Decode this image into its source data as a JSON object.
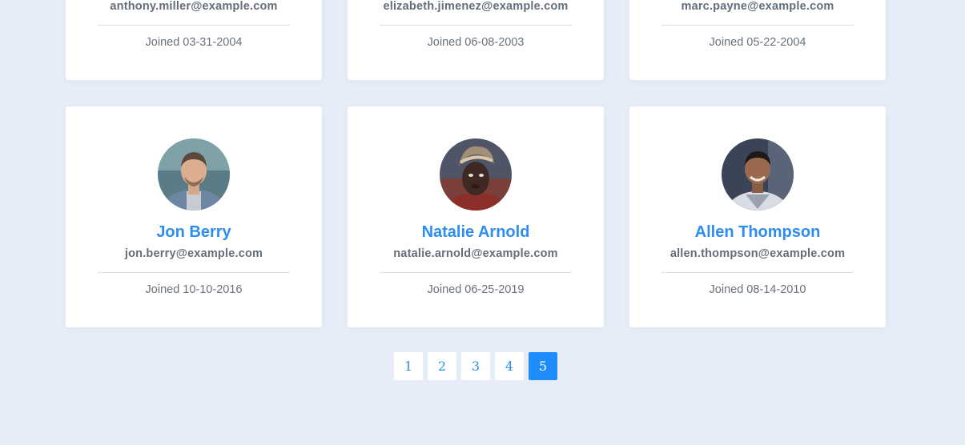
{
  "users": {
    "top_row": [
      {
        "email": "anthony.miller@example.com",
        "joined": "Joined 03-31-2004"
      },
      {
        "email": "elizabeth.jimenez@example.com",
        "joined": "Joined 06-08-2003"
      },
      {
        "email": "marc.payne@example.com",
        "joined": "Joined 05-22-2004"
      }
    ],
    "bottom_row": [
      {
        "name": "Jon Berry",
        "email": "jon.berry@example.com",
        "joined": "Joined 10-10-2016",
        "avatar": "user-photo"
      },
      {
        "name": "Natalie Arnold",
        "email": "natalie.arnold@example.com",
        "joined": "Joined 06-25-2019",
        "avatar": "user-photo"
      },
      {
        "name": "Allen Thompson",
        "email": "allen.thompson@example.com",
        "joined": "Joined 08-14-2010",
        "avatar": "user-photo"
      }
    ]
  },
  "pagination": {
    "pages": [
      "1",
      "2",
      "3",
      "4",
      "5"
    ],
    "current": "5"
  },
  "colors": {
    "background": "#e6edf8",
    "accent": "#2d8ef0",
    "active_page": "#1e8cfa"
  }
}
